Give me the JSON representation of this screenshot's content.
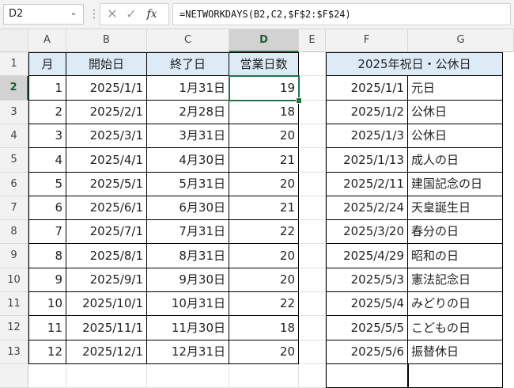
{
  "name_box": {
    "value": "D2"
  },
  "formula_bar": {
    "formula": "=NETWORKDAYS(B2,C2,$F$2:$F$24)",
    "cancel_glyph": "✕",
    "enter_glyph": "✓",
    "fx_glyph": "fx",
    "more_glyph": "⋮",
    "drop_glyph": "⌄"
  },
  "columns": [
    "A",
    "B",
    "C",
    "D",
    "E",
    "F",
    "G"
  ],
  "selected_column": "D",
  "row_numbers": [
    "1",
    "2",
    "3",
    "4",
    "5",
    "6",
    "7",
    "8",
    "9",
    "10",
    "11",
    "12",
    "13",
    ""
  ],
  "selected_row": "2",
  "table_headers": {
    "month": "月",
    "start": "開始日",
    "end": "終了日",
    "workdays": "営業日数"
  },
  "monthly_rows": [
    {
      "month": "1",
      "start": "2025/1/1",
      "end": "1月31日",
      "days": "19"
    },
    {
      "month": "2",
      "start": "2025/2/1",
      "end": "2月28日",
      "days": "18"
    },
    {
      "month": "3",
      "start": "2025/3/1",
      "end": "3月31日",
      "days": "20"
    },
    {
      "month": "4",
      "start": "2025/4/1",
      "end": "4月30日",
      "days": "21"
    },
    {
      "month": "5",
      "start": "2025/5/1",
      "end": "5月31日",
      "days": "20"
    },
    {
      "month": "6",
      "start": "2025/6/1",
      "end": "6月30日",
      "days": "21"
    },
    {
      "month": "7",
      "start": "2025/7/1",
      "end": "7月31日",
      "days": "22"
    },
    {
      "month": "8",
      "start": "2025/8/1",
      "end": "8月31日",
      "days": "20"
    },
    {
      "month": "9",
      "start": "2025/9/1",
      "end": "9月30日",
      "days": "20"
    },
    {
      "month": "10",
      "start": "2025/10/1",
      "end": "10月31日",
      "days": "22"
    },
    {
      "month": "11",
      "start": "2025/11/1",
      "end": "11月30日",
      "days": "18"
    },
    {
      "month": "12",
      "start": "2025/12/1",
      "end": "12月31日",
      "days": "20"
    }
  ],
  "holiday_header": "2025年祝日・公休日",
  "holidays": [
    {
      "date": "2025/1/1",
      "name": "元日"
    },
    {
      "date": "2025/1/2",
      "name": "公休日"
    },
    {
      "date": "2025/1/3",
      "name": "公休日"
    },
    {
      "date": "2025/1/13",
      "name": "成人の日"
    },
    {
      "date": "2025/2/11",
      "name": "建国記念の日"
    },
    {
      "date": "2025/2/24",
      "name": "天皇誕生日"
    },
    {
      "date": "2025/3/20",
      "name": "春分の日"
    },
    {
      "date": "2025/4/29",
      "name": "昭和の日"
    },
    {
      "date": "2025/5/3",
      "name": "憲法記念日"
    },
    {
      "date": "2025/5/4",
      "name": "みどりの日"
    },
    {
      "date": "2025/5/5",
      "name": "こどもの日"
    },
    {
      "date": "2025/5/6",
      "name": "振替休日"
    }
  ],
  "colors": {
    "header_fill": "#ddebf7",
    "selection": "#217346"
  }
}
